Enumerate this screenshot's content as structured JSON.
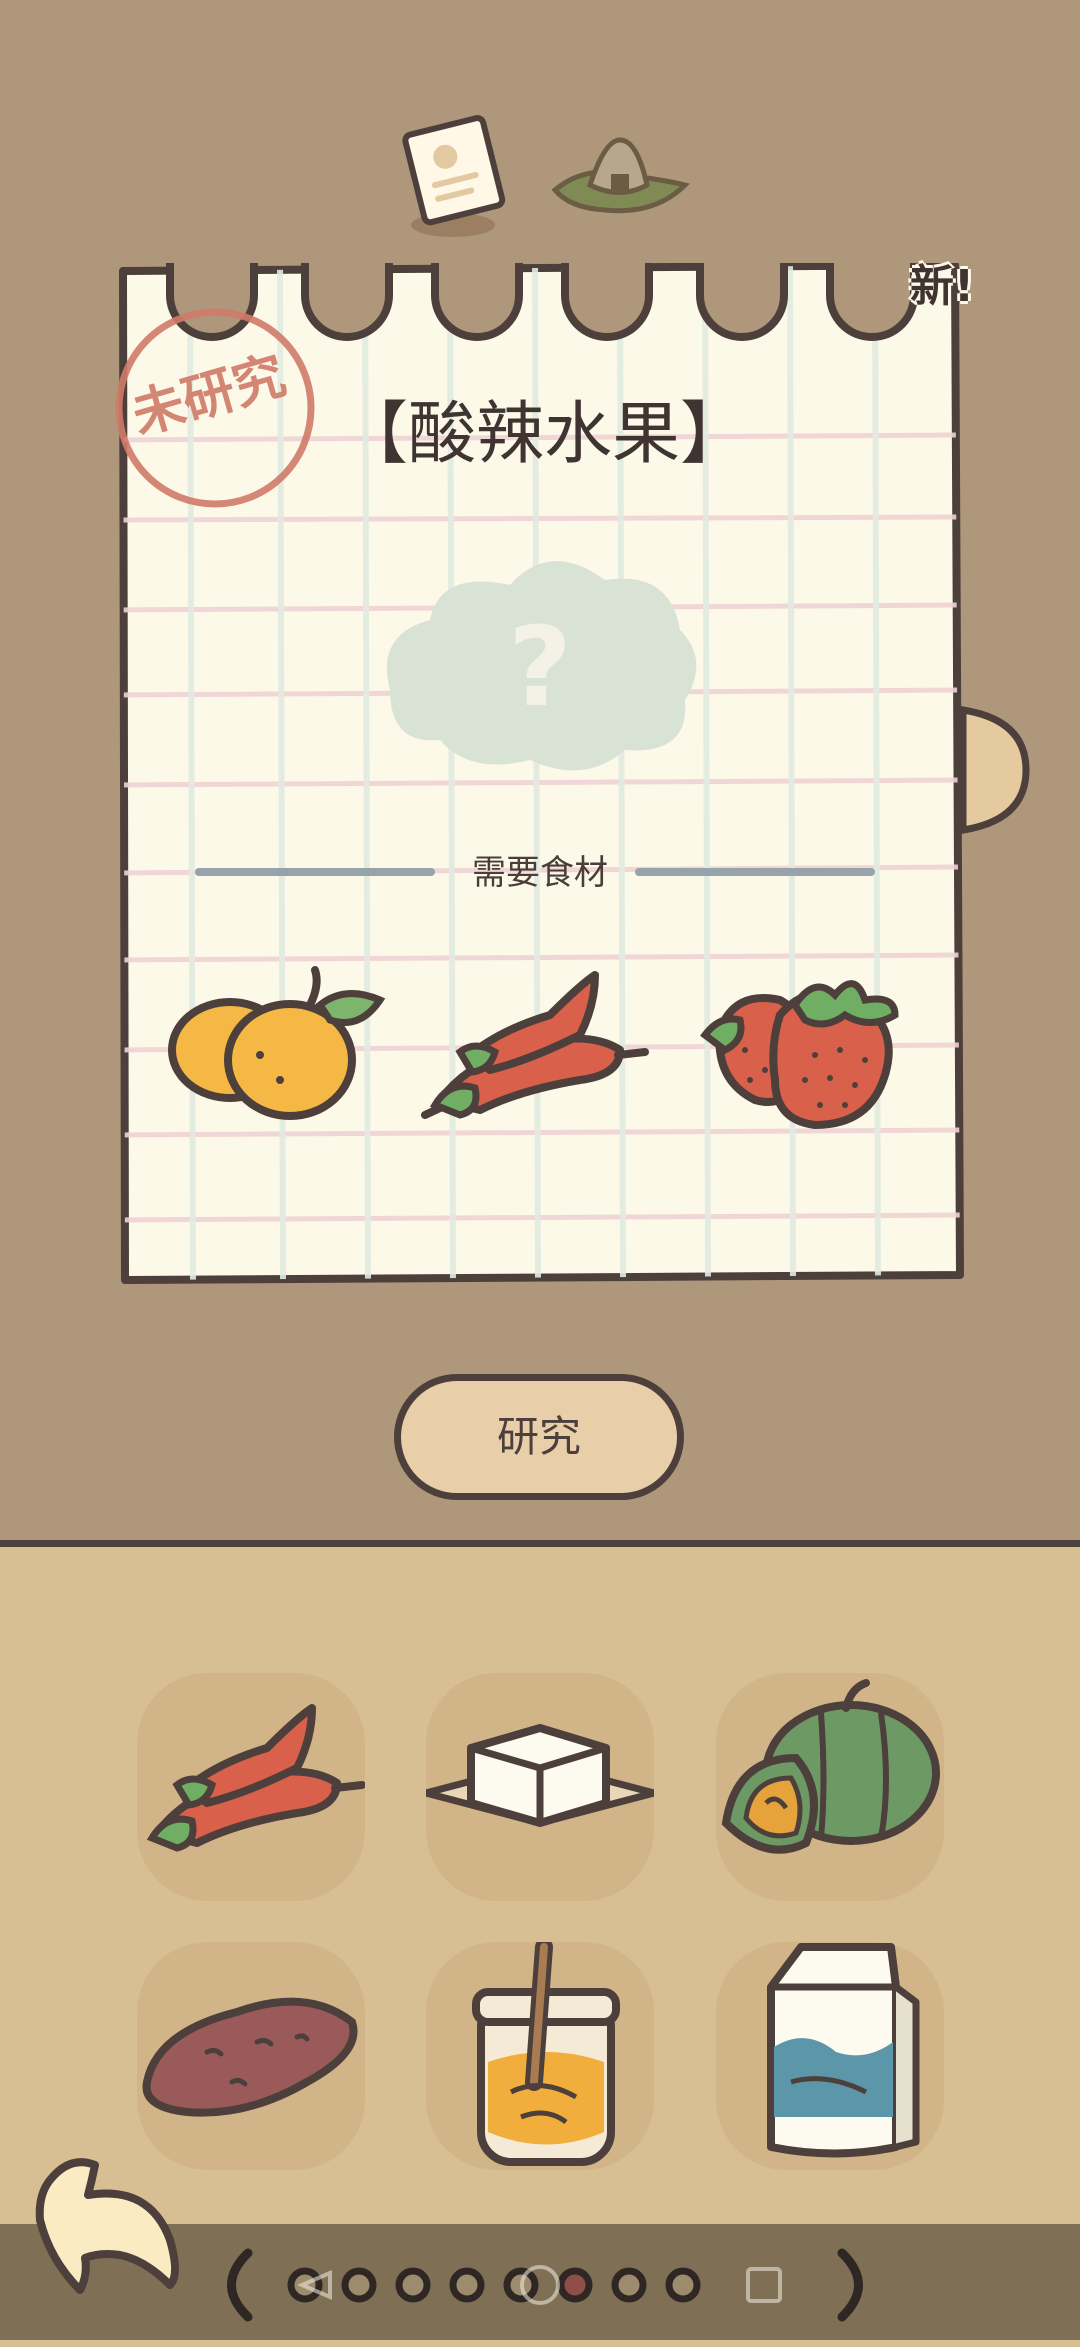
{
  "note": {
    "title": "【酸辣水果】",
    "stamp_text": "未研究",
    "new_badge": "新!",
    "unknown_symbol": "?",
    "needs_label": "需要食材",
    "required_ingredients": [
      "loquat",
      "chili-pepper",
      "strawberry"
    ]
  },
  "actions": {
    "research_label": "研究"
  },
  "inventory": {
    "items": [
      "chili-pepper",
      "tofu",
      "pumpkin",
      "sweet-potato",
      "honey-jar",
      "milk-carton"
    ]
  },
  "pager": {
    "page_count": 8,
    "current_page": 6
  },
  "colors": {
    "background": "#ae977b",
    "paper": "#fdf9e9",
    "outline": "#4d3f3b",
    "stamp": "#d07a68",
    "button_fill": "#e9ceaa",
    "inventory_bg": "#d8bf93"
  }
}
